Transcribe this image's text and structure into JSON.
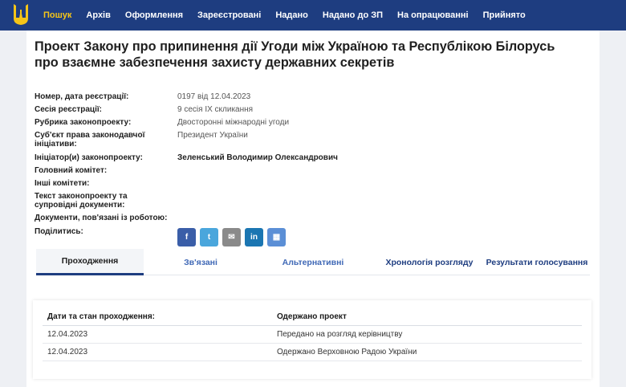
{
  "nav": {
    "items": [
      "Пошук",
      "Архів",
      "Оформлення",
      "Зареєстровані",
      "Надано",
      "Надано до ЗП",
      "На опрацюванні",
      "Прийнято"
    ],
    "active_color": "#f5c518",
    "bar_color": "#1e3d80"
  },
  "bill": {
    "title": "Проект Закону про припинення дії Угоди між Україною та Республікою Білорусь про взаємне забезпечення захисту державних секретів"
  },
  "info": {
    "reg_label": "Номер, дата реєстрації:",
    "reg_value": "0197 від 12.04.2023",
    "session_label": "Сесія реєстрації:",
    "session_value": "9 сесія IX скликання",
    "rubric_label": "Рубрика законопроекту:",
    "rubric_value": "Двосторонні міжнародні угоди",
    "subject_label": "Суб'єкт права законодавчої ініціативи:",
    "subject_value": "Президент України",
    "initiator_label": "Ініціатор(и) законопроекту:",
    "initiator_value": "Зеленський Володимир Олександрович",
    "main_committee_label": "Головний комітет:",
    "other_committees_label": "Інші комітети:",
    "text_label": "Текст законопроекту та супровідні документи:",
    "docs_label": "Документи, пов'язані із роботою:",
    "share_label": "Поділитись:"
  },
  "share_icons": [
    "facebook-icon",
    "twitter-icon",
    "email-icon",
    "linkedin-icon",
    "qr-code-icon"
  ],
  "share_glyphs": {
    "facebook": "f",
    "twitter": "t",
    "email": "✉",
    "linkedin": "in",
    "qr": "▦"
  },
  "tabs": [
    "Проходження",
    "Зв'язані",
    "Альтернативні",
    "Хронологія розгляду",
    "Результати голосування"
  ],
  "table": {
    "headers": [
      "Дати та стан проходження:",
      "Одержано проект"
    ],
    "rows": [
      [
        "12.04.2023",
        "Передано на розгляд керівництву"
      ],
      [
        "12.04.2023",
        "Одержано Верховною Радою України"
      ]
    ]
  }
}
